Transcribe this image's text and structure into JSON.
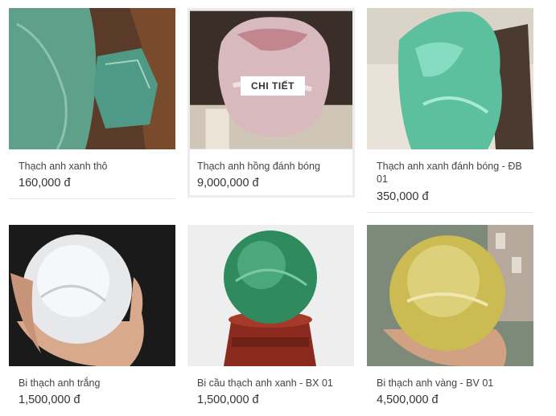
{
  "products": [
    {
      "name": "Thạch anh xanh thô",
      "price": "160,000 đ",
      "image": "green-quartz-rough-photo"
    },
    {
      "name": "Thạch anh hồng đánh bóng",
      "price": "9,000,000 đ",
      "image": "rose-quartz-polished-photo",
      "button": "CHI TIẾT"
    },
    {
      "name": "Thạch anh xanh đánh bóng - ĐB 01",
      "price": "350,000 đ",
      "image": "green-quartz-polished-photo"
    },
    {
      "name": "Bi thạch anh trắng",
      "price": "1,500,000 đ",
      "image": "clear-quartz-sphere-photo"
    },
    {
      "name": "Bi cầu thạch anh xanh - BX 01",
      "price": "1,500,000 đ",
      "image": "green-fluorite-sphere-photo"
    },
    {
      "name": "Bi thạch anh vàng - BV 01",
      "price": "4,500,000 đ",
      "image": "citrine-sphere-photo"
    }
  ]
}
